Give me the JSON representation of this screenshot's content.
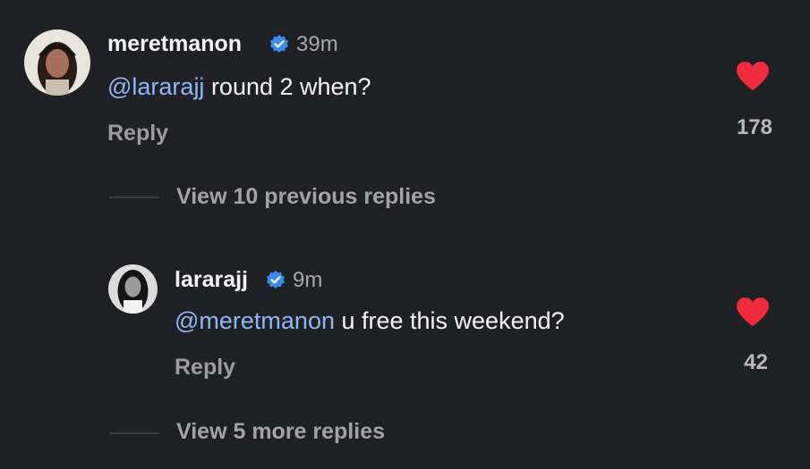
{
  "comment1": {
    "username": "meretmanon",
    "time": "39m",
    "mention": "@lararajj",
    "text": " round 2 when?",
    "reply_label": "Reply",
    "likes": "178",
    "liked": true
  },
  "view_previous": "View 10 previous replies",
  "comment2": {
    "username": "lararajj",
    "time": "9m",
    "mention": "@meretmanon",
    "text": " u free this weekend?",
    "reply_label": "Reply",
    "likes": "42",
    "liked": true
  },
  "view_more": "View 5 more replies",
  "colors": {
    "background": "#1f2024",
    "mention": "#8fb7f2",
    "verified": "#3b8cf0",
    "heart": "#f02b3c"
  },
  "icons": {
    "verified": "verified-badge-icon",
    "like": "heart-icon"
  }
}
